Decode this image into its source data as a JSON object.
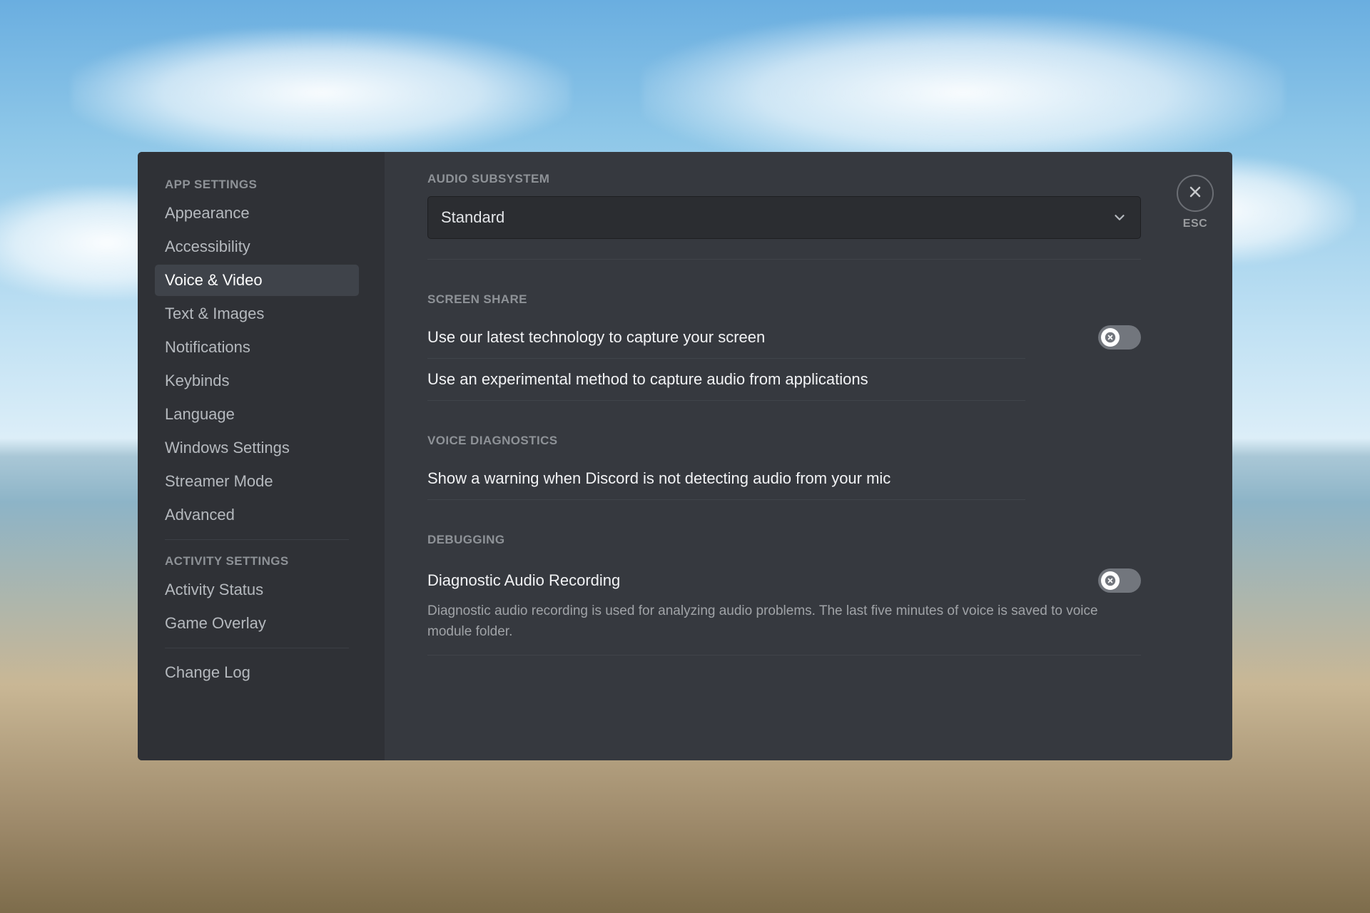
{
  "sidebar": {
    "headers": {
      "app": "APP SETTINGS",
      "activity": "ACTIVITY SETTINGS"
    },
    "app_items": [
      {
        "label": "Appearance",
        "active": false
      },
      {
        "label": "Accessibility",
        "active": false
      },
      {
        "label": "Voice & Video",
        "active": true
      },
      {
        "label": "Text & Images",
        "active": false
      },
      {
        "label": "Notifications",
        "active": false
      },
      {
        "label": "Keybinds",
        "active": false
      },
      {
        "label": "Language",
        "active": false
      },
      {
        "label": "Windows Settings",
        "active": false
      },
      {
        "label": "Streamer Mode",
        "active": false
      },
      {
        "label": "Advanced",
        "active": false
      }
    ],
    "activity_items": [
      {
        "label": "Activity Status"
      },
      {
        "label": "Game Overlay"
      }
    ],
    "extra_items": [
      {
        "label": "Change Log"
      }
    ]
  },
  "content": {
    "audio_subsystem": {
      "header": "AUDIO SUBSYSTEM",
      "value": "Standard"
    },
    "screen_share": {
      "header": "SCREEN SHARE",
      "row1": "Use our latest technology to capture your screen",
      "row1_on": false,
      "row2": "Use an experimental method to capture audio from applications"
    },
    "voice_diag": {
      "header": "VOICE DIAGNOSTICS",
      "row1": "Show a warning when Discord is not detecting audio from your mic"
    },
    "debugging": {
      "header": "DEBUGGING",
      "row1": "Diagnostic Audio Recording",
      "row1_on": false,
      "desc": "Diagnostic audio recording is used for analyzing audio problems. The last five minutes of voice is saved to voice module folder."
    }
  },
  "close": {
    "label": "ESC"
  }
}
